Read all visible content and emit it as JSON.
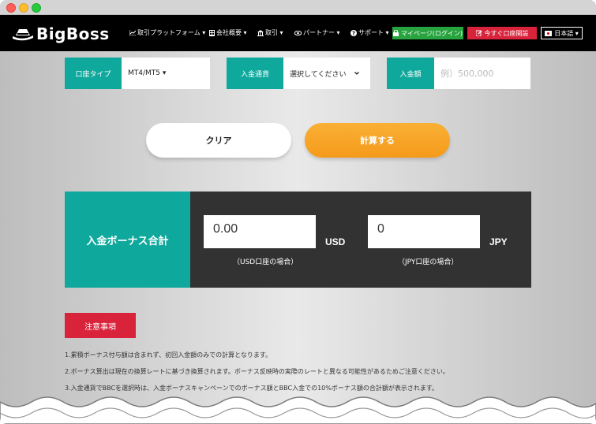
{
  "window": {
    "close": "",
    "minimize": "",
    "maximize": ""
  },
  "nav": {
    "brand": "BigBoss",
    "items": [
      {
        "label": "取引プラットフォーム ▾",
        "icon": "chart-icon"
      },
      {
        "label": "会社概要 ▾",
        "icon": "building-icon"
      },
      {
        "label": "取引 ▾",
        "icon": "bank-icon"
      },
      {
        "label": "パートナー ▾",
        "icon": "eye-icon"
      },
      {
        "label": "サポート ▾",
        "icon": "question-icon"
      }
    ],
    "mypage": "マイページ(ログイン)",
    "open_account": "今すぐ口座開設",
    "language": "日本語 ▾"
  },
  "form": {
    "account_type_label": "口座タイプ",
    "account_type_value": "MT4/MT5 ▾",
    "currency_label": "入金通貨",
    "currency_value": "選択してください",
    "amount_label": "入金額",
    "amount_placeholder": "例）500,000"
  },
  "actions": {
    "clear": "クリア",
    "calculate": "計算する"
  },
  "result": {
    "label": "入金ボーナス合計",
    "usd_value": "0.00",
    "usd_unit": "USD",
    "usd_note": "（USD口座の場合）",
    "jpy_value": "0",
    "jpy_unit": "JPY",
    "jpy_note": "（JPY口座の場合）"
  },
  "notice": {
    "title": "注意事項",
    "items": [
      "1.累積ボーナス付与額は含まれず、初回入金額のみでの計算となります。",
      "2.ボーナス算出は現在の換算レートに基づき換算されます。ボーナス反映時の実際のレートと異なる可能性があるためご注意ください。",
      "3.入金通貨でBBCを選択時は、入金ボーナスキャンペーンでのボーナス額とBBC入金での10%ボーナス額の合計額が表示されます。"
    ]
  },
  "colors": {
    "teal": "#0fa89c",
    "orange": "#f7a124",
    "red": "#d8233b",
    "green": "#27a33f",
    "dark": "#323232"
  }
}
